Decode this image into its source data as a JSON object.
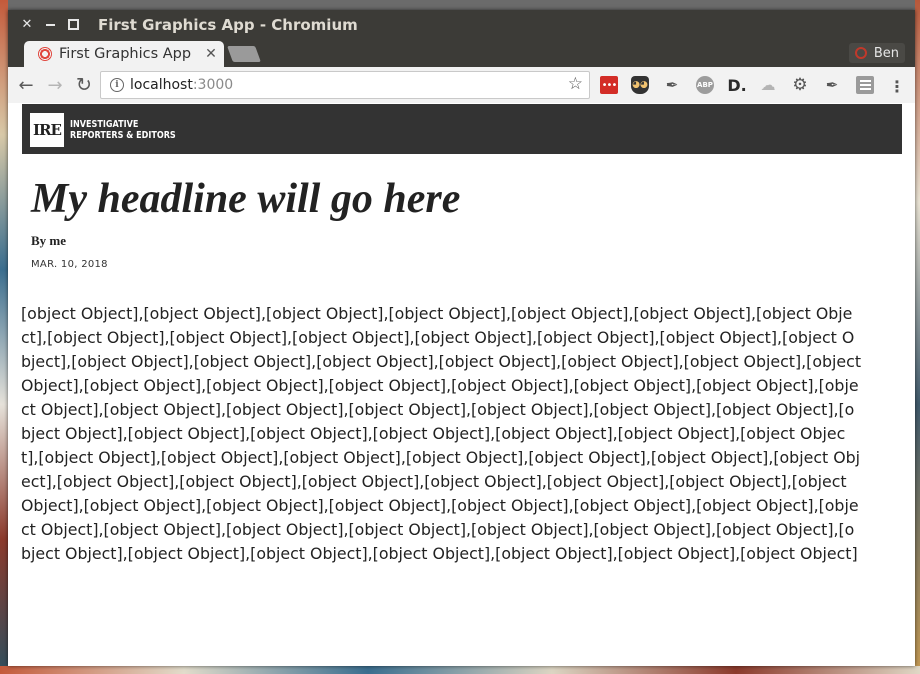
{
  "window": {
    "title": "First Graphics App - Chromium",
    "close_glyph": "✕"
  },
  "tab": {
    "label": "First Graphics App",
    "close_glyph": "✕"
  },
  "profile": {
    "name": "Ben"
  },
  "address_bar": {
    "host": "localhost",
    "port": ":3000",
    "info_glyph": "i"
  },
  "extensions": [
    {
      "name": "lastpass-icon",
      "glyph": "•••"
    },
    {
      "name": "owl-icon",
      "glyph": "◕◕"
    },
    {
      "name": "pin-icon",
      "glyph": "✒"
    },
    {
      "name": "adblock-icon",
      "glyph": "ABP"
    },
    {
      "name": "d-icon",
      "glyph": "D."
    },
    {
      "name": "cloud-icon",
      "glyph": "☁"
    },
    {
      "name": "gear-icon",
      "glyph": "⚙"
    },
    {
      "name": "pushpin-icon",
      "glyph": "✒"
    },
    {
      "name": "document-icon",
      "glyph": ""
    }
  ],
  "site": {
    "logo_text": "IRE",
    "org_line1": "INVESTIGATIVE",
    "org_line2": "REPORTERS & EDITORS"
  },
  "article": {
    "headline": "My headline will go here",
    "byline": "By me",
    "date": "MAR. 10, 2018",
    "body": "[object Object],[object Object],[object Object],[object Object],[object Object],[object Object],[object Object],[object Object],[object Object],[object Object],[object Object],[object Object],[object Object],[object Object],[object Object],[object Object],[object Object],[object Object],[object Object],[object Object],[object Object],[object Object],[object Object],[object Object],[object Object],[object Object],[object Object],[object Object],[object Object],[object Object],[object Object],[object Object],[object Object],[object Object],[object Object],[object Object],[object Object],[object Object],[object Object],[object Object],[object Object],[object Object],[object Object],[object Object],[object Object],[object Object],[object Object],[object Object],[object Object],[object Object],[object Object],[object Object],[object Object],[object Object],[object Object],[object Object],[object Object],[object Object],[object Object],[object Object],[object Object],[object Object],[object Object],[object Object],[object Object],[object Object],[object Object],[object Object],[object Object],[object Object],[object Object],[object Object],[object Object],[object Object],[object Object]"
  },
  "colors": {
    "titlebar": "#3c3b37",
    "masthead": "#333333",
    "favicon": "#e0473e"
  }
}
